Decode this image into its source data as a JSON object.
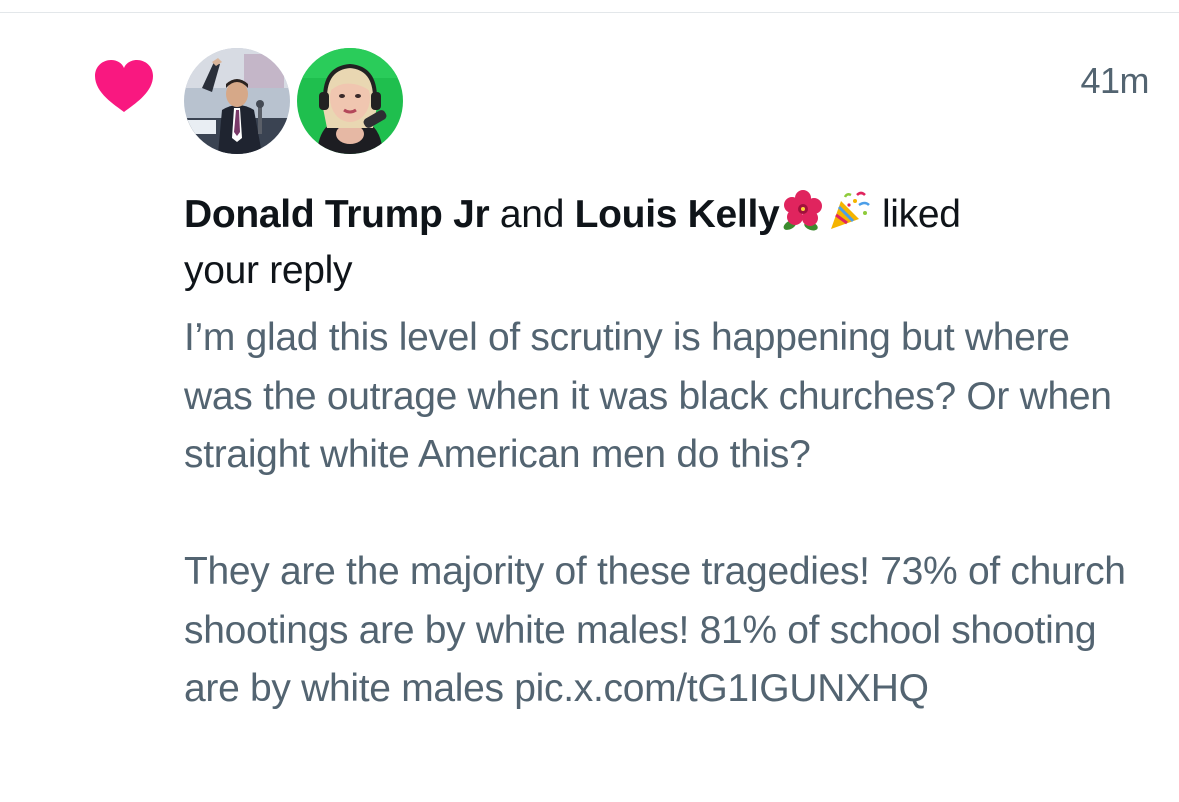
{
  "notification": {
    "timestamp": "41m",
    "likers": [
      {
        "name": "Donald Trump Jr",
        "avatar_icon": "avatar-man-suit-icon"
      },
      {
        "name": "Louis Kelly",
        "avatar_icon": "avatar-woman-headset-icon"
      }
    ],
    "connector": "and",
    "name_emojis": [
      "hibiscus-icon",
      "party-popper-icon"
    ],
    "action_part1": "liked",
    "action_part2": "your reply",
    "reply_paragraph_1": "I’m glad this level of scrutiny is happening but where was the outrage when it was black churches? Or when straight white American men do this?",
    "reply_paragraph_2": "They are the majority of these tragedies! 73% of church shootings are by white males! 81% of school shooting are by white males pic.x.com/tG1IGUNXHQ",
    "heart_color": "#f91880"
  }
}
